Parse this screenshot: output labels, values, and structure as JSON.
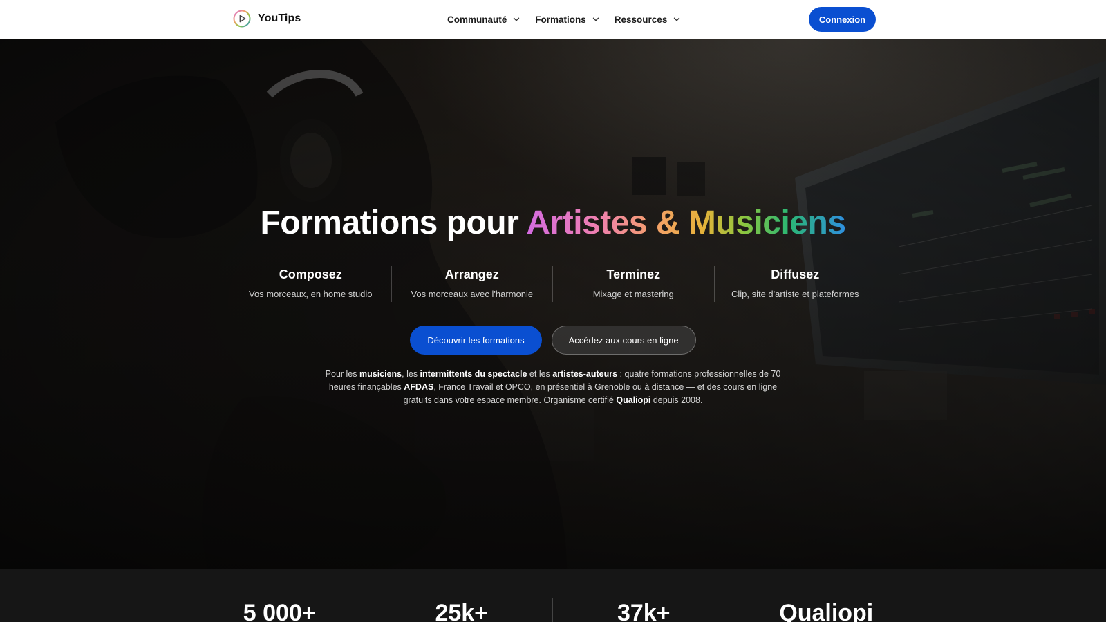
{
  "navbar": {
    "brand": "YouTips",
    "menu": [
      {
        "label": "Communauté"
      },
      {
        "label": "Formations"
      },
      {
        "label": "Ressources"
      }
    ],
    "login_label": "Connexion"
  },
  "hero": {
    "title_plain": "Formations pour ",
    "title_highlight": "Artistes & Musiciens",
    "steps": [
      {
        "title": "Composez",
        "subtitle": "Vos morceaux, en home studio"
      },
      {
        "title": "Arrangez",
        "subtitle": "Vos morceaux avec l'harmonie"
      },
      {
        "title": "Terminez",
        "subtitle": "Mixage et mastering"
      },
      {
        "title": "Diffusez",
        "subtitle": "Clip, site d'artiste et plateformes"
      }
    ],
    "primary_cta": "Découvrir les formations",
    "secondary_cta": "Accédez aux cours en ligne",
    "description": {
      "p1": "Pour les ",
      "b1": "musiciens",
      "p2": ", les ",
      "b2": "intermittents du spectacle",
      "p3": " et les ",
      "b3": "artistes-auteurs",
      "p4": " : quatre formations professionnelles de 70 heures finançables ",
      "b4": "AFDAS",
      "p5": ", France Travail et OPCO, en présentiel à Grenoble ou à distance — et des cours en ligne gratuits dans votre espace membre. Organisme certifié ",
      "b5": "Qualiopi",
      "p6": " depuis 2008."
    }
  },
  "stats": [
    {
      "value": "5 000+"
    },
    {
      "value": "25k+"
    },
    {
      "value": "37k+"
    },
    {
      "value": "Qualiopi"
    }
  ],
  "colors": {
    "accent": "#0a4fd1",
    "navbar_bg": "#ffffff",
    "stats_bg": "#161616"
  }
}
